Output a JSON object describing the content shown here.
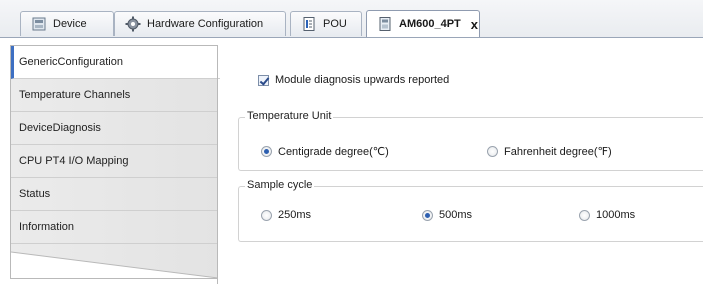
{
  "tabs": [
    {
      "label": "Device",
      "icon": "device-icon",
      "active": false
    },
    {
      "label": "Hardware Configuration",
      "icon": "gear-icon",
      "active": false
    },
    {
      "label": "POU",
      "icon": "document-icon",
      "active": false
    },
    {
      "label": "AM600_4PT",
      "icon": "module-icon",
      "active": true,
      "close": "x"
    }
  ],
  "sidebar": {
    "items": [
      {
        "label": "GenericConfiguration",
        "active": true
      },
      {
        "label": "Temperature Channels"
      },
      {
        "label": "DeviceDiagnosis"
      },
      {
        "label": "CPU PT4 I/O Mapping"
      },
      {
        "label": "Status"
      },
      {
        "label": "Information"
      }
    ]
  },
  "settings": {
    "diagnosis_label": "Module diagnosis upwards reported",
    "diagnosis_checked": true,
    "temperature_unit": {
      "title": "Temperature Unit",
      "options": [
        {
          "label": "Centigrade degree(℃)",
          "checked": true
        },
        {
          "label": "Fahrenheit degree(℉)",
          "checked": false
        }
      ]
    },
    "sample_cycle": {
      "title": "Sample cycle",
      "options": [
        {
          "label": "250ms",
          "checked": false
        },
        {
          "label": "500ms",
          "checked": true
        },
        {
          "label": "1000ms",
          "checked": false
        }
      ]
    }
  },
  "colors": {
    "accent": "#3d6fc2",
    "tab_border": "#a9b3c2",
    "nav_bg": "#e6e6e6"
  }
}
